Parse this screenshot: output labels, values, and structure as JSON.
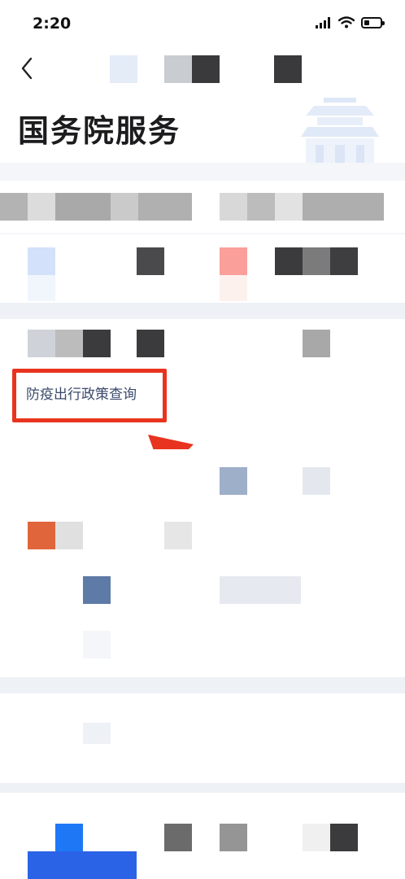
{
  "status_bar": {
    "time": "2:20"
  },
  "nav": {
    "back": "back"
  },
  "header": {
    "title": "国务院服务"
  },
  "main": {
    "highlighted_item": "防疫出行政策查询"
  },
  "colors": {
    "highlight": "#e8341f",
    "arrow": "#e8341f",
    "brand_blue": "#1e6ff5"
  }
}
